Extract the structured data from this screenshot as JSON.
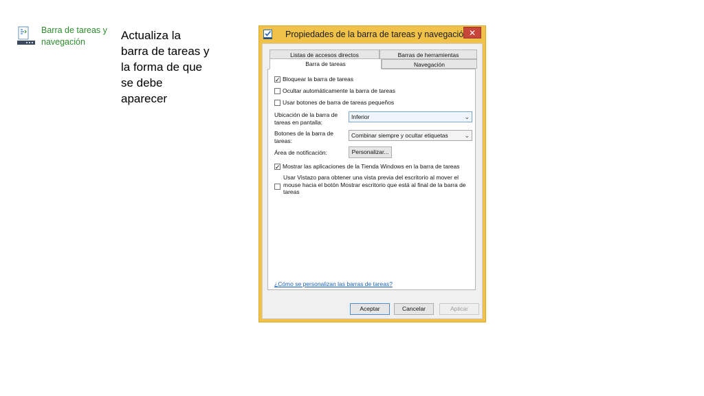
{
  "control_panel_item": {
    "label": "Barra de tareas y navegación",
    "icon": "taskbar-settings-icon",
    "label_color": "#2e8b2e"
  },
  "instruction": "Actualiza la barra de tareas y la forma de que se debe aparecer",
  "dialog": {
    "title": "Propiedades de la barra de tareas y navegación",
    "close_label": "✕",
    "frame_color": "#f0c24a",
    "tabs": [
      {
        "label": "Listas de accesos directos"
      },
      {
        "label": "Barras de herramientas"
      },
      {
        "label": "Barra de tareas"
      },
      {
        "label": "Navegación"
      }
    ],
    "checkboxes": {
      "lock": {
        "label": "Bloquear la barra de tareas",
        "checked": true
      },
      "autohide": {
        "label": "Ocultar automáticamente la barra de tareas",
        "checked": false
      },
      "small_buttons": {
        "label": "Usar botones de barra de tareas pequeños",
        "checked": false
      },
      "store_apps": {
        "label": "Mostrar las aplicaciones de la Tienda Windows en la barra de tareas",
        "checked": true
      },
      "peek": {
        "label": "Usar Vistazo para obtener una vista previa del escritorio al mover el mouse hacia el botón Mostrar escritorio que está al final de la barra de tareas",
        "checked": false
      }
    },
    "location": {
      "label": "Ubicación de la barra de tareas en pantalla:",
      "value": "Inferior"
    },
    "buttons_combine": {
      "label": "Botones de la barra de tareas:",
      "value": "Combinar siempre y ocultar etiquetas"
    },
    "notification_area": {
      "label": "Área de notificación:",
      "button": "Personalizar..."
    },
    "help_link": "¿Cómo se personalizan las barras de tareas?",
    "footer": {
      "accept": "Aceptar",
      "cancel": "Cancelar",
      "apply": "Aplicar"
    }
  }
}
